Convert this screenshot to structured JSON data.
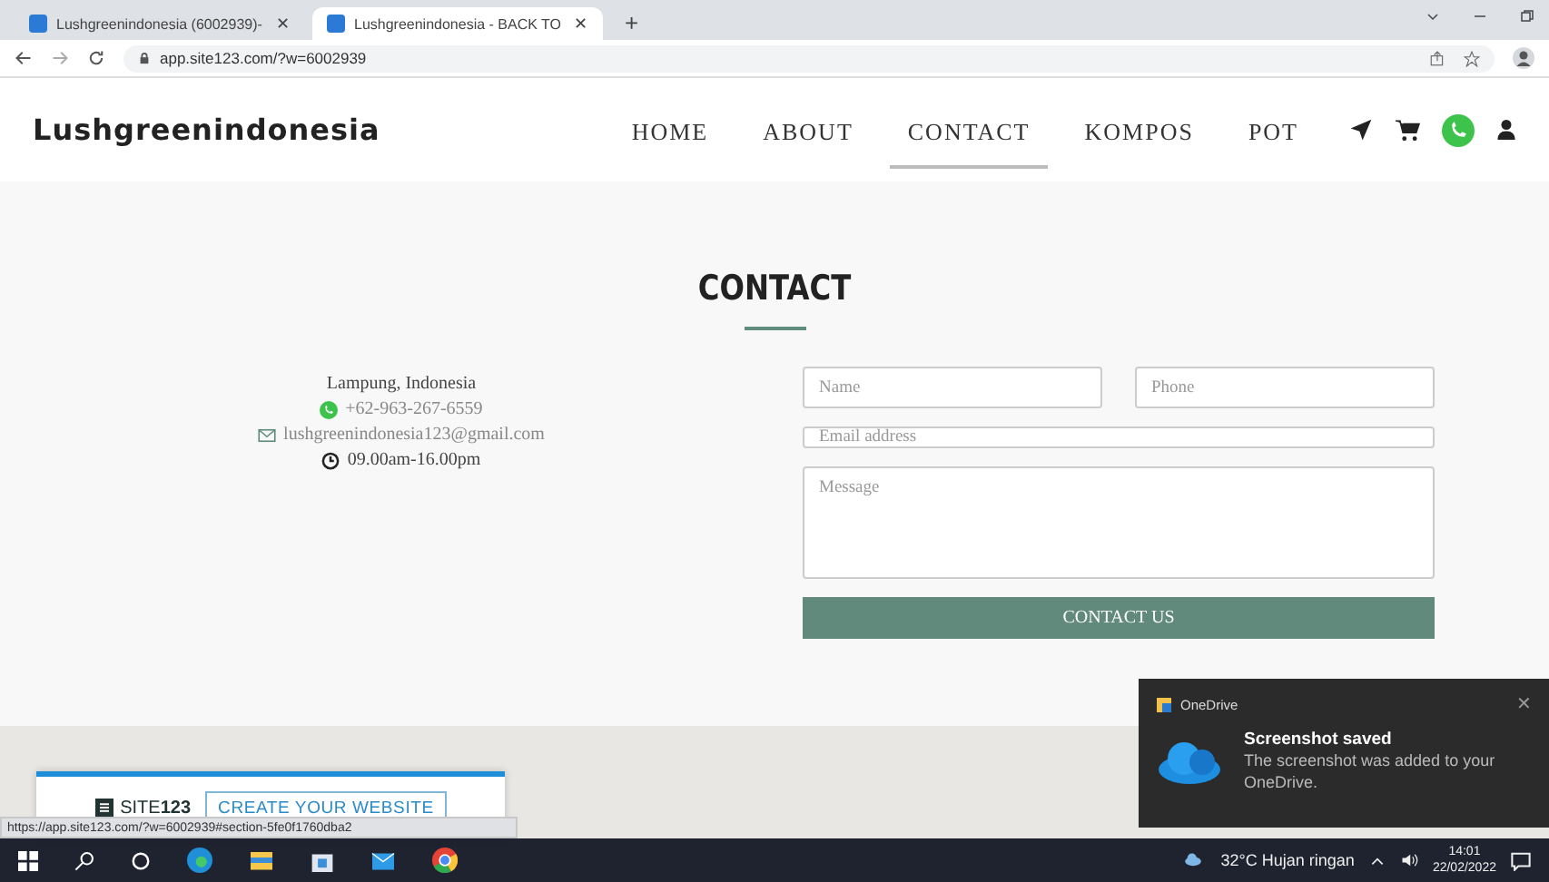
{
  "browser": {
    "tabs": [
      {
        "title": "Lushgreenindonesia (6002939)- ",
        "selected": false
      },
      {
        "title": "Lushgreenindonesia - BACK TO ",
        "selected": true
      }
    ],
    "tab_close": "✕",
    "new_tab": "+",
    "url": "app.site123.com/?w=6002939"
  },
  "site": {
    "logo": "Lushgreenindonesia",
    "nav": [
      {
        "label": "HOME",
        "selected": false
      },
      {
        "label": "ABOUT",
        "selected": false
      },
      {
        "label": "CONTACT",
        "selected": true
      },
      {
        "label": "KOMPOS",
        "selected": false
      },
      {
        "label": "POT",
        "selected": false
      }
    ]
  },
  "contact": {
    "title": "CONTACT",
    "address": "Lampung, Indonesia",
    "phone": "+62-963-267-6559",
    "email": "lushgreenindonesia123@gmail.com",
    "hours": "09.00am-16.00pm",
    "form": {
      "name_placeholder": "Name",
      "phone_placeholder": "Phone",
      "email_placeholder": "Email address",
      "message_placeholder": "Message",
      "submit": "CONTACT US"
    }
  },
  "banner": {
    "brand": "SITE",
    "brand_number": "123",
    "button": "CREATE YOUR WEBSITE"
  },
  "status_url": "https://app.site123.com/?w=6002939#section-5fe0f1760dba2",
  "notification": {
    "app": "OneDrive",
    "close": "✕",
    "title": "Screenshot saved",
    "body": "The screenshot was added to your OneDrive."
  },
  "taskbar": {
    "weather": "32°C  Hujan ringan",
    "time": "14:01",
    "date": "22/02/2022"
  }
}
